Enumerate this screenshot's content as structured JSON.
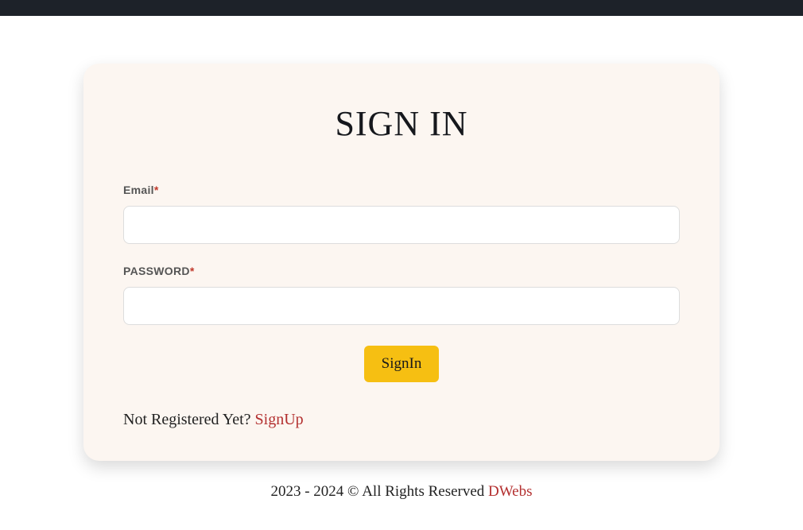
{
  "form": {
    "title": "SIGN IN",
    "email": {
      "label": "Email",
      "required_mark": "*",
      "value": ""
    },
    "password": {
      "label": "PASSWORD",
      "required_mark": "*",
      "value": ""
    },
    "submit_label": "SignIn",
    "not_registered_text": "Not Registered Yet? ",
    "signup_link_text": "SignUp"
  },
  "footer": {
    "copyright_text": "2023 - 2024 © All Rights Reserved ",
    "brand": "DWebs"
  }
}
